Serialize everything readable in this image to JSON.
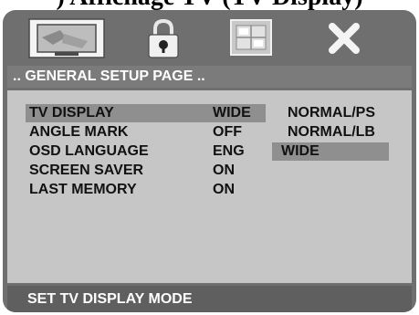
{
  "document": {
    "title": ") Affichage TV (TV Display)"
  },
  "icons": [
    "tv-setup-icon",
    "lock-icon",
    "grid-settings-icon",
    "close-icon"
  ],
  "page": {
    "title": ".. GENERAL SETUP PAGE .."
  },
  "settings": [
    {
      "label": "TV DISPLAY",
      "value": "WIDE"
    },
    {
      "label": "ANGLE MARK",
      "value": "OFF"
    },
    {
      "label": "OSD LANGUAGE",
      "value": "ENG"
    },
    {
      "label": "SCREEN SAVER",
      "value": "ON"
    },
    {
      "label": "LAST MEMORY",
      "value": "ON"
    }
  ],
  "options": [
    "NORMAL/PS",
    "NORMAL/LB",
    "WIDE"
  ],
  "selected_option": "WIDE",
  "status": "SET TV DISPLAY MODE",
  "colors": {
    "frame": "#6f6f6f",
    "panel": "#c6c6c6",
    "highlight": "#8f8f8f",
    "status_bar": "#5f5f5f"
  }
}
